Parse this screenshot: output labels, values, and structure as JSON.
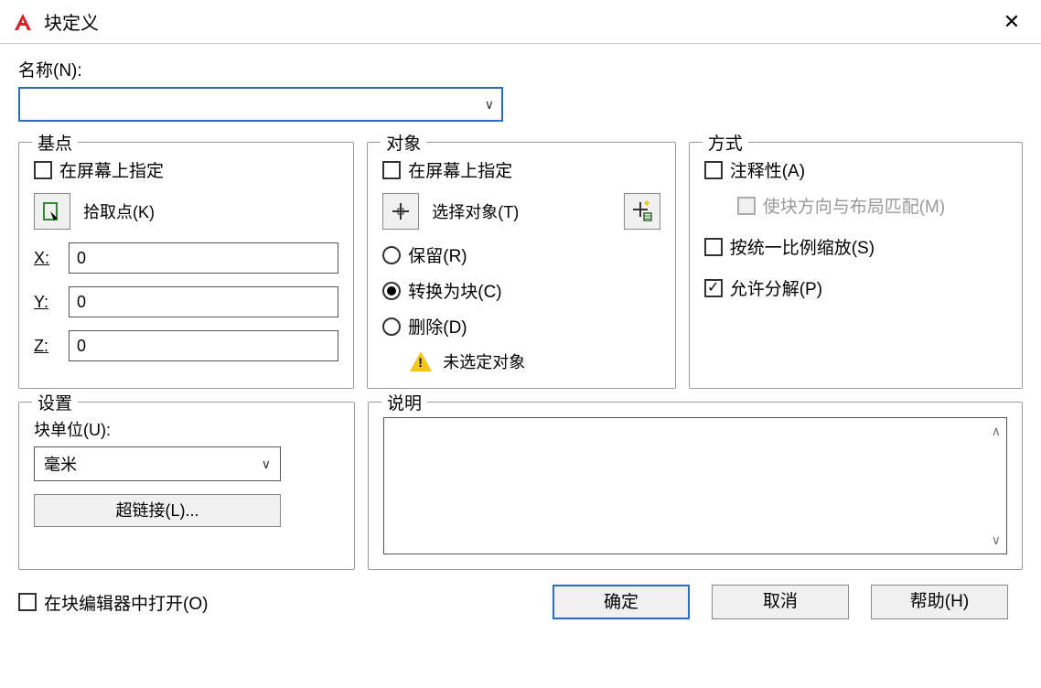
{
  "title": "块定义",
  "name_label": "名称(N):",
  "name_value": "",
  "base": {
    "legend": "基点",
    "specify": "在屏幕上指定",
    "pick": "拾取点(K)",
    "x_label": "X:",
    "y_label": "Y:",
    "z_label": "Z:",
    "x": "0",
    "y": "0",
    "z": "0"
  },
  "objects": {
    "legend": "对象",
    "specify": "在屏幕上指定",
    "select": "选择对象(T)",
    "retain": "保留(R)",
    "convert": "转换为块(C)",
    "delete": "删除(D)",
    "warn": "未选定对象"
  },
  "mode": {
    "legend": "方式",
    "annotative": "注释性(A)",
    "match": "使块方向与布局匹配(M)",
    "scale": "按统一比例缩放(S)",
    "explode": "允许分解(P)"
  },
  "settings": {
    "legend": "设置",
    "units_label": "块单位(U):",
    "units_value": "毫米",
    "hyperlink": "超链接(L)..."
  },
  "desc": {
    "legend": "说明"
  },
  "open_in_editor": "在块编辑器中打开(O)",
  "buttons": {
    "ok": "确定",
    "cancel": "取消",
    "help": "帮助(H)"
  }
}
